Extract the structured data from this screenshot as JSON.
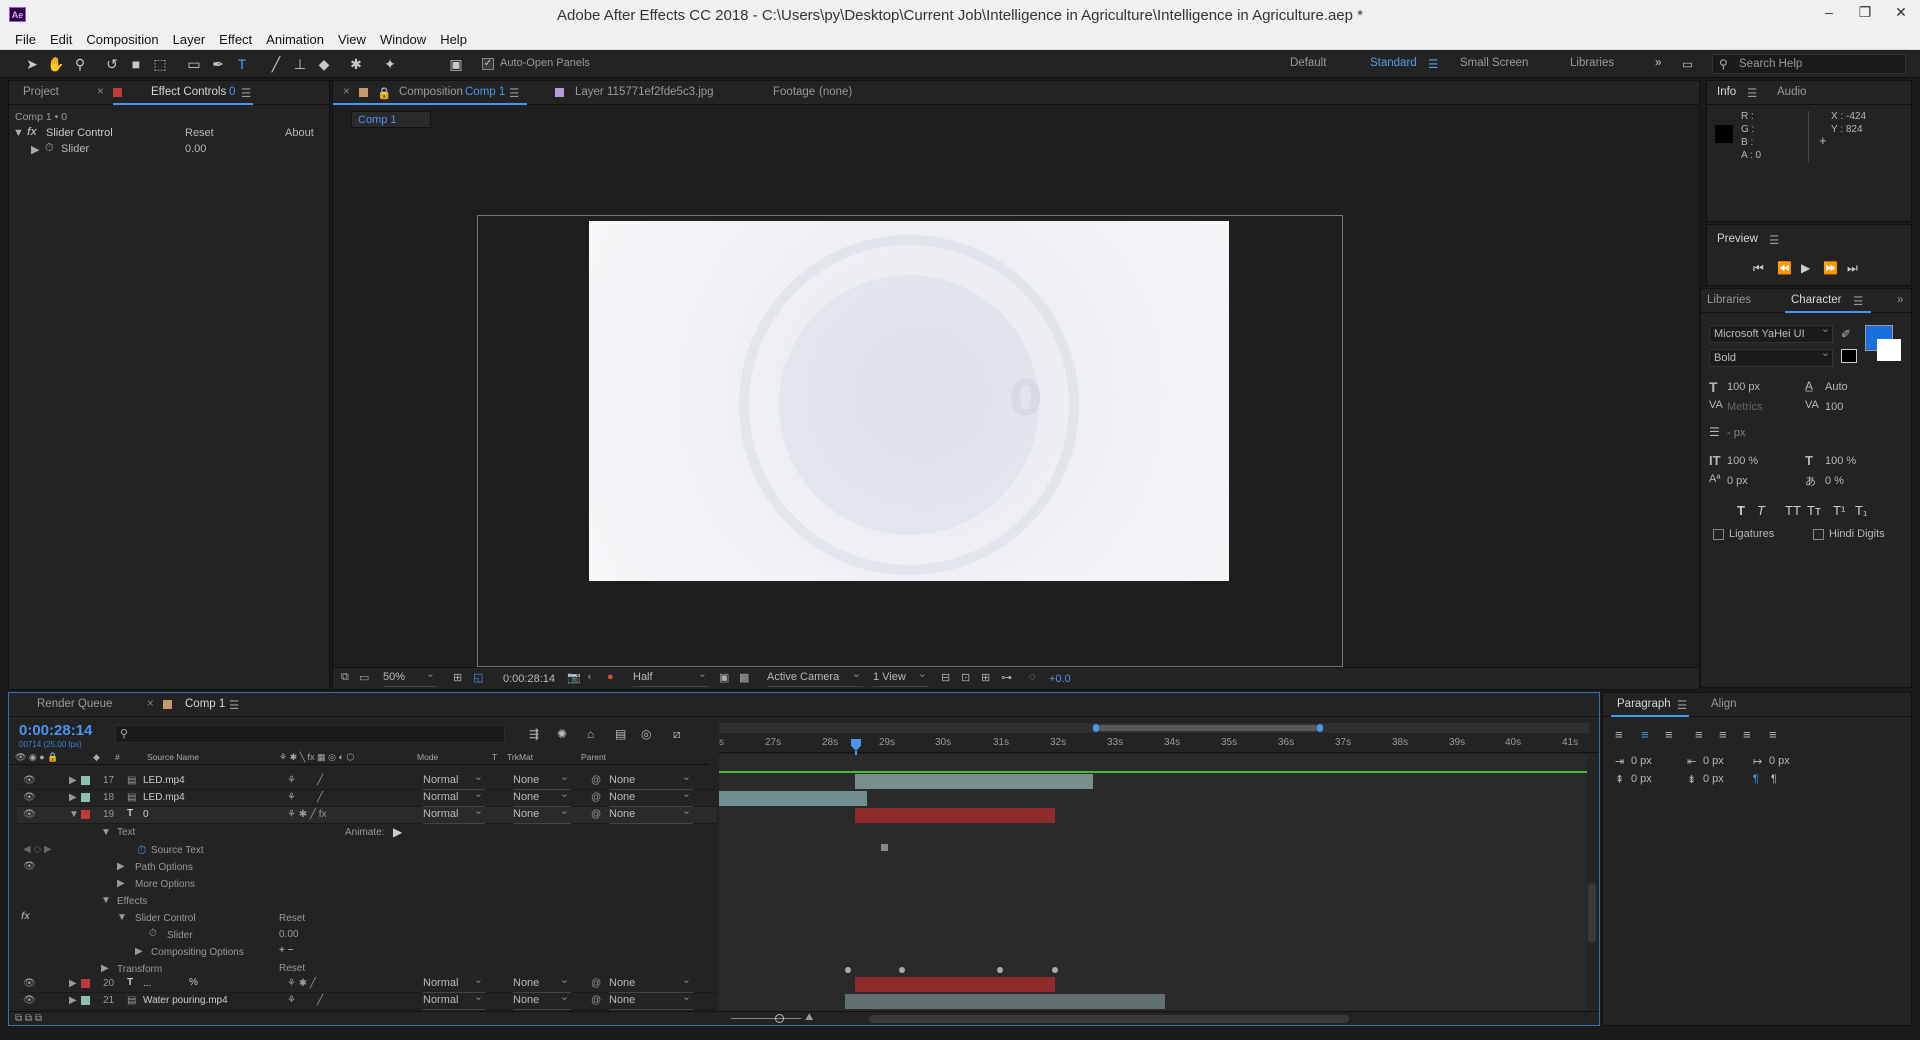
{
  "window": {
    "title": "Adobe After Effects CC 2018 - C:\\Users\\py\\Desktop\\Current Job\\Intelligence in Agriculture\\Intelligence in Agriculture.aep *",
    "app_icon": "Ae"
  },
  "menu": [
    "File",
    "Edit",
    "Composition",
    "Layer",
    "Effect",
    "Animation",
    "View",
    "Window",
    "Help"
  ],
  "toolbar": {
    "auto_open": "Auto-Open Panels",
    "workspaces": [
      "Default",
      "Standard",
      "Small Screen",
      "Libraries"
    ],
    "active_workspace": "Standard",
    "search_help": "Search Help"
  },
  "project_panel": {
    "tabs": [
      "Project",
      "Effect Controls",
      "0"
    ],
    "comp_label": "Comp 1 • 0",
    "effect": {
      "name": "Slider Control",
      "reset": "Reset",
      "about": "About",
      "property": "Slider",
      "value": "0.00"
    }
  },
  "comp_panel": {
    "tabs": [
      {
        "label": "Composition",
        "name": "Comp 1"
      },
      {
        "label": "Layer",
        "name": "115771ef2fde5c3.jpg"
      },
      {
        "label": "Footage",
        "name": "(none)"
      }
    ],
    "breadcrumb": "Comp 1",
    "overlay_number": "0",
    "viewer_bar": {
      "zoom": "50%",
      "timecode": "0:00:28:14",
      "resolution": "Half",
      "camera": "Active Camera",
      "views": "1 View",
      "exposure": "+0.0"
    }
  },
  "info_panel": {
    "tabs": [
      "Info",
      "Audio"
    ],
    "r": "R :",
    "g": "G :",
    "b": "B :",
    "a": "A : 0",
    "x": "X : -424",
    "y": "Y : 824"
  },
  "preview_panel": {
    "title": "Preview"
  },
  "character_panel": {
    "tabs": [
      "Libraries",
      "Character"
    ],
    "font": "Microsoft YaHei UI",
    "style": "Bold",
    "size": "100 px",
    "leading": "Auto",
    "kerning": "Metrics",
    "tracking": "100",
    "stroke": "- px",
    "vscale": "100 %",
    "hscale": "100 %",
    "baseline": "0 px",
    "tsume": "0 %",
    "ligatures": "Ligatures",
    "hindi": "Hindi Digits",
    "fill_color": "#1a6fe0"
  },
  "paragraph_panel": {
    "tabs": [
      "Paragraph",
      "Align"
    ],
    "indent_left": "0 px",
    "indent_right": "0 px",
    "indent_first": "0 px",
    "space_before": "0 px",
    "space_after": "0 px"
  },
  "timeline": {
    "tabs": [
      "Render Queue",
      "Comp 1"
    ],
    "timecode": "0:00:28:14",
    "fps": "00714 (25.00 fps)",
    "columns": {
      "num": "#",
      "source": "Source Name",
      "mode": "Mode",
      "t": "T",
      "trkmat": "TrkMat",
      "parent": "Parent"
    },
    "ticks": [
      "s",
      "27s",
      "28s",
      "29s",
      "30s",
      "31s",
      "32s",
      "33s",
      "34s",
      "35s",
      "36s",
      "37s",
      "38s",
      "39s",
      "40s",
      "41s"
    ],
    "layers": [
      {
        "num": "17",
        "name": "LED.mp4",
        "type": "footage",
        "color": "#8fbfb3",
        "mode": "Normal",
        "trkmat": "None",
        "parent": "None"
      },
      {
        "num": "18",
        "name": "LED.mp4",
        "type": "footage",
        "color": "#8fbfb3",
        "mode": "Normal",
        "trkmat": "None",
        "parent": "None"
      },
      {
        "num": "19",
        "name": "0",
        "type": "text",
        "color": "#c0393b",
        "mode": "Normal",
        "trkmat": "None",
        "parent": "None"
      },
      {
        "num": "20",
        "name": "...",
        "type": "text",
        "color": "#c0393b",
        "mode": "Normal",
        "trkmat": "None",
        "parent": "None"
      },
      {
        "num": "21",
        "name": "Water pouring.mp4",
        "type": "footage",
        "color": "#8fbfb3",
        "mode": "Normal",
        "trkmat": "None",
        "parent": "None"
      }
    ],
    "props": {
      "text": "Text",
      "animate": "Animate:",
      "source_text": "Source Text",
      "path_options": "Path Options",
      "more_options": "More Options",
      "effects": "Effects",
      "slider_control": "Slider Control",
      "reset": "Reset",
      "slider": "Slider",
      "slider_value": "0.00",
      "compositing": "Compositing Options",
      "transform": "Transform",
      "transform_reset": "Reset"
    }
  }
}
